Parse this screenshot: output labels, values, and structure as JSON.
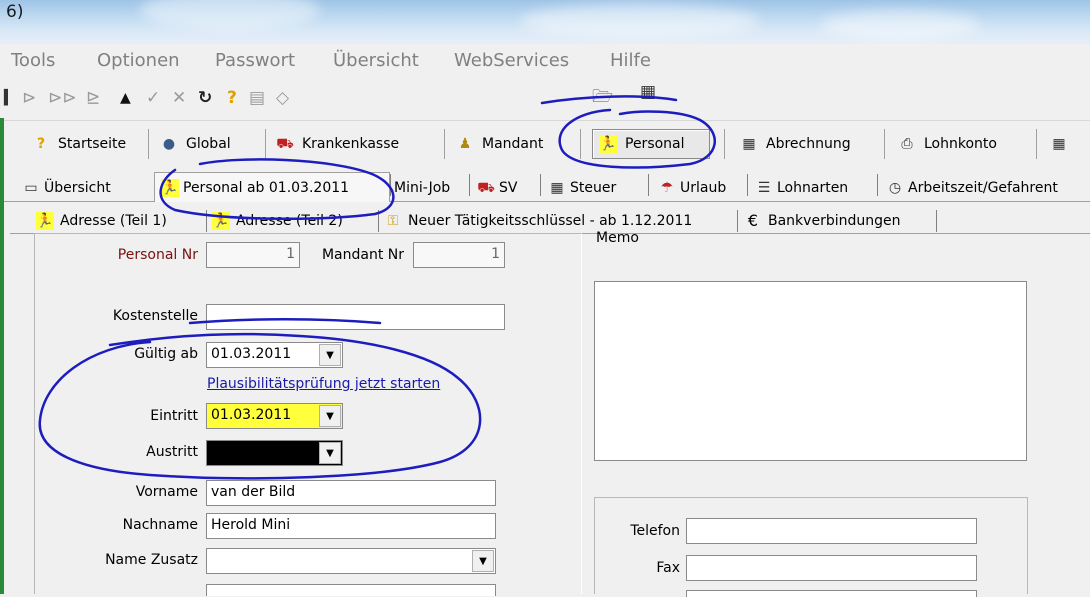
{
  "window": {
    "title": "6)"
  },
  "menu": [
    "Tools",
    "Optionen",
    "Passwort",
    "Übersicht",
    "WebServices",
    "Hilfe"
  ],
  "nav": [
    {
      "label": "Startseite",
      "icon": "help-icon"
    },
    {
      "label": "Global",
      "icon": "globe-icon"
    },
    {
      "label": "Krankenkasse",
      "icon": "ambulance-icon"
    },
    {
      "label": "Mandant",
      "icon": "people-icon"
    },
    {
      "label": "Personal",
      "icon": "person-icon"
    },
    {
      "label": "Abrechnung",
      "icon": "calculator-icon"
    },
    {
      "label": "Lohnkonto",
      "icon": "printer-icon"
    }
  ],
  "tabs": [
    "Übersicht",
    "Personal ab 01.03.2011",
    "Mini-Job",
    "SV",
    "Steuer",
    "Urlaub",
    "Lohnarten",
    "Arbeitszeit/Gefahrent"
  ],
  "subtabs": [
    "Adresse (Teil 1)",
    "Adresse (Teil 2)",
    "Neuer Tätigkeitsschlüssel - ab 1.12.2011",
    "Bankverbindungen"
  ],
  "form": {
    "personal_nr_label": "Personal Nr",
    "personal_nr": "1",
    "mandant_nr_label": "Mandant Nr",
    "mandant_nr": "1",
    "kostenstelle_label": "Kostenstelle",
    "kostenstelle": "",
    "gueltig_ab_label": "Gültig ab",
    "gueltig_ab": "01.03.2011",
    "plausi_link": "Plausibilitätsprüfung jetzt starten",
    "eintritt_label": "Eintritt",
    "eintritt": "01.03.2011",
    "austritt_label": "Austritt",
    "austritt": "",
    "vorname_label": "Vorname",
    "vorname": "van der Bild",
    "nachname_label": "Nachname",
    "nachname": "Herold Mini",
    "name_zusatz_label": "Name Zusatz",
    "name_zusatz": ""
  },
  "memo_label": "Memo",
  "contact": {
    "telefon_label": "Telefon",
    "telefon": "",
    "fax_label": "Fax",
    "fax": ""
  },
  "colors": {
    "highlight_yellow": "#ffff3c",
    "link_blue": "#1a1aa6",
    "personal_nr_label": "#7a1010",
    "annotation_ink": "#1d1dbf",
    "left_edge_green": "#2a8a3a"
  }
}
